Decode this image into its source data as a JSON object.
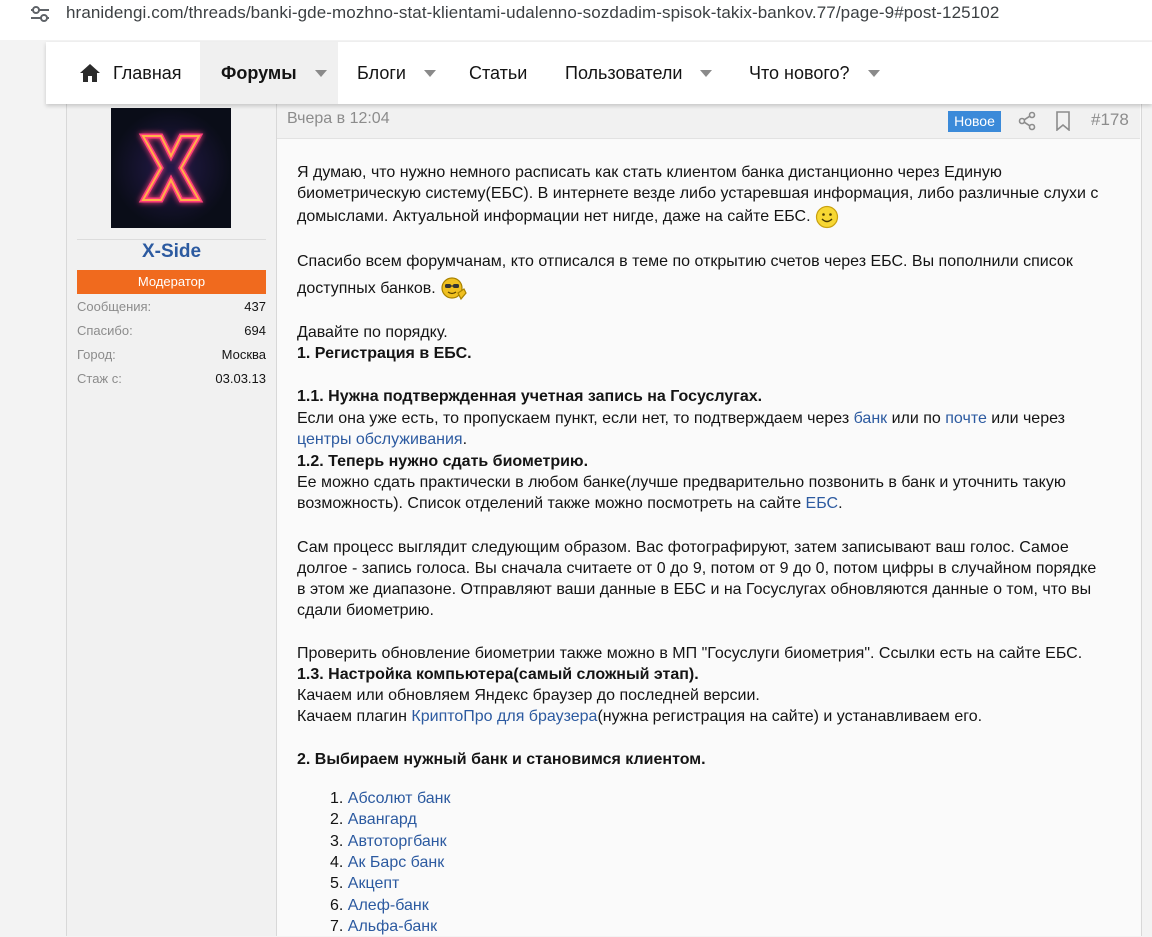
{
  "browser": {
    "url": "hranidengi.com/threads/banki-gde-mozhno-stat-klientami-udalenno-sozdadim-spisok-takix-bankov.77/page-9#post-125102"
  },
  "nav": {
    "home": "Главная",
    "forums": "Форумы",
    "blogs": "Блоги",
    "articles": "Статьи",
    "users": "Пользователи",
    "whats_new": "Что нового?"
  },
  "user": {
    "name": "X-Side",
    "role": "Модератор",
    "stats": [
      {
        "label": "Сообщения:",
        "value": "437"
      },
      {
        "label": "Спасибо:",
        "value": "694"
      },
      {
        "label": "Город:",
        "value": "Москва"
      },
      {
        "label": "Стаж с:",
        "value": "03.03.13"
      }
    ]
  },
  "post": {
    "date": "Вчера в 12:04",
    "badge": "Новое",
    "number": "#178",
    "p1_l1": "Я думаю, что нужно немного расписать как стать клиентом банка дистанционно через Единую",
    "p1_l2": "биометрическую систему(ЕБС). В интернете везде либо устаревшая информация, либо различные слухи с",
    "p1_l3": "домыслами. Актуальной информации нет нигде, даже на сайте ЕБС.",
    "p2_l1": "Спасибо всем форумчанам, кто отписался в теме по открытию счетов через ЕБС. Вы пополнили список",
    "p2_l2": "доступных банков.",
    "p3_l1": "Давайте по порядку.",
    "h1": "1. Регистрация в ЕБС.",
    "h11": "1.1. Нужна подтвержденная учетная запись на Госуслугах.",
    "p4_a": "Если она уже есть, то пропускаем пункт, если нет, то подтверждаем через ",
    "p4_link1": "банк",
    "p4_b": " или по ",
    "p4_link2": "почте",
    "p4_c": " или через",
    "p4_link3": "центры обслуживания",
    "p4_d": ".",
    "h12": "1.2. Теперь нужно сдать биометрию.",
    "p5_l1": "Ее можно сдать практически в любом банке(лучше предварительно позвонить в банк и уточнить такую",
    "p5_l2a": "возможность). Список отделений также можно посмотреть на сайте ",
    "p5_link": "ЕБС",
    "p5_l2b": ".",
    "p6_l1": "Сам процесс выглядит следующим образом. Вас фотографируют, затем записывают ваш голос. Самое",
    "p6_l2": "долгое - запись голоса. Вы сначала считаете от 0 до 9, потом от 9 до 0, потом цифры в случайном порядке",
    "p6_l3": "в этом же диапазоне. Отправляют ваши данные в ЕБС и на Госуслугах обновляются данные о том, что вы",
    "p6_l4": "сдали биометрию.",
    "p7_l1": "Проверить обновление биометрии также можно в МП \"Госуслуги биометрия\". Ссылки есть на сайте ЕБС.",
    "h13": "1.3. Настройка компьютера(самый сложный этап).",
    "p8_l1": "Качаем или обновляем Яндекс браузер до последней версии.",
    "p8_l2a": "Качаем плагин ",
    "p8_link": "КриптоПро для браузера",
    "p8_l2b": "(нужна регистрация на сайте) и устанавливаем его.",
    "h2": "2. Выбираем нужный банк и становимся клиентом.",
    "banks": [
      {
        "num": "1.",
        "name": "Абсолют банк"
      },
      {
        "num": "2.",
        "name": "Авангард"
      },
      {
        "num": "3.",
        "name": "Автоторгбанк"
      },
      {
        "num": "4.",
        "name": "Ак Барс банк"
      },
      {
        "num": "5.",
        "name": "Акцепт"
      },
      {
        "num": "6.",
        "name": "Алеф-банк"
      },
      {
        "num": "7.",
        "name": "Альфа-банк"
      }
    ]
  }
}
